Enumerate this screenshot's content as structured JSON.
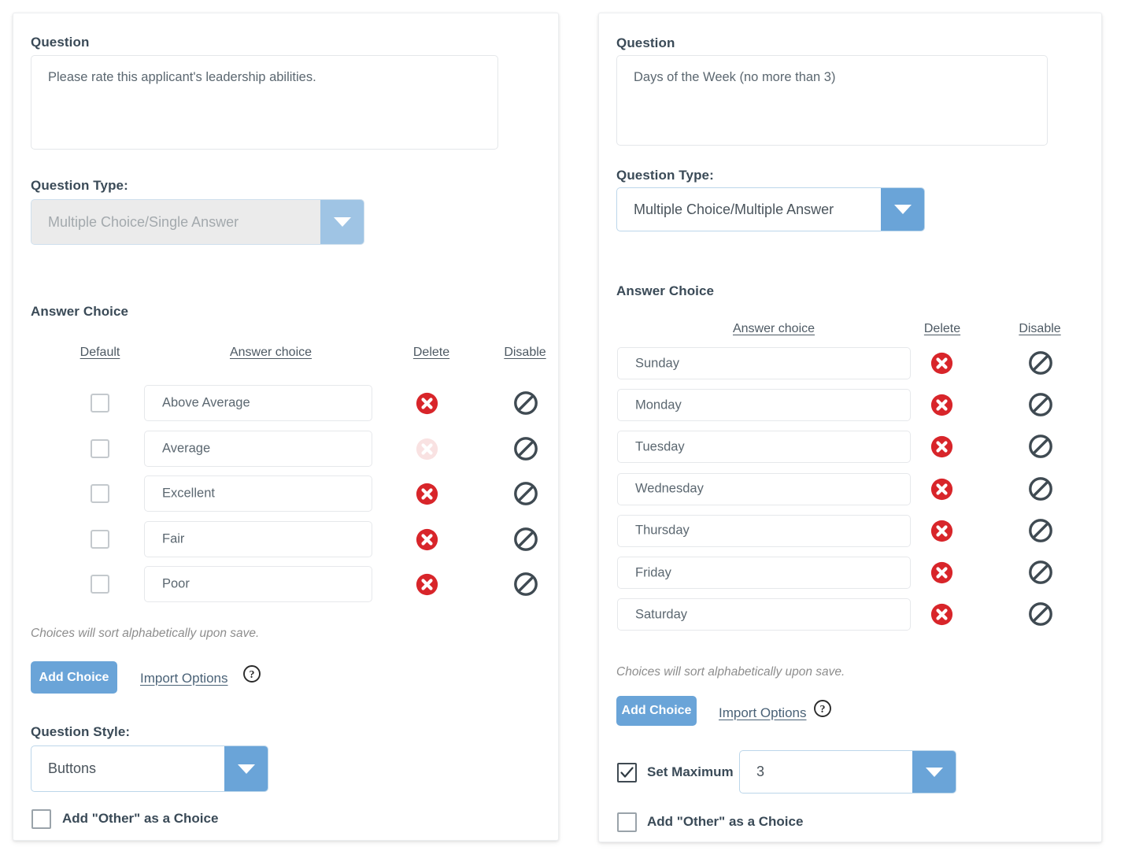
{
  "theme": {
    "accent_blue": "#6aa4d8",
    "accent_blue_muted": "#9fc4e4",
    "delete_red": "#d8252a",
    "disable_dark": "#3f4a52",
    "text_dark": "#3a4a57",
    "text_gray": "#5b6770",
    "note_gray": "#8d8d8d",
    "link_color": "#4a6277",
    "panel_bg": "#ffffff",
    "disabled_bg": "#ebebeb"
  },
  "left_panel": {
    "question_label": "Question",
    "question_text": "Please rate this applicant's leadership abilities.",
    "question_type_label": "Question Type:",
    "question_type_value": "Multiple Choice/Single Answer",
    "question_type_disabled": true,
    "answer_choice_label": "Answer Choice",
    "columns": {
      "default": "Default",
      "answer_choice": "Answer choice",
      "delete": "Delete",
      "disable": "Disable"
    },
    "rows": [
      {
        "default_checked": false,
        "text": "Above Average",
        "delete_icon": "delete-circle-x-icon",
        "delete_faded": false,
        "disable_icon": "disable-slash-icon"
      },
      {
        "default_checked": false,
        "text": "Average",
        "delete_icon": "delete-circle-x-icon",
        "delete_faded": true,
        "disable_icon": "disable-slash-icon"
      },
      {
        "default_checked": false,
        "text": "Excellent",
        "delete_icon": "delete-circle-x-icon",
        "delete_faded": false,
        "disable_icon": "disable-slash-icon"
      },
      {
        "default_checked": false,
        "text": "Fair",
        "delete_icon": "delete-circle-x-icon",
        "delete_faded": false,
        "disable_icon": "disable-slash-icon"
      },
      {
        "default_checked": false,
        "text": "Poor",
        "delete_icon": "delete-circle-x-icon",
        "delete_faded": false,
        "disable_icon": "disable-slash-icon"
      }
    ],
    "sort_note": "Choices will sort alphabetically upon save.",
    "add_choice_label": "Add Choice",
    "import_options_label": "Import Options",
    "help_icon": "help-question-circle-icon",
    "question_style_label": "Question Style:",
    "question_style_value": "Buttons",
    "add_other_label": "Add \"Other\" as a Choice",
    "add_other_checked": false
  },
  "right_panel": {
    "question_label": "Question",
    "question_text": "Days of the Week (no more than 3)",
    "question_type_label": "Question Type:",
    "question_type_value": "Multiple Choice/Multiple Answer",
    "question_type_disabled": false,
    "answer_choice_label": "Answer Choice",
    "columns": {
      "answer_choice": "Answer choice",
      "delete": "Delete",
      "disable": "Disable"
    },
    "rows": [
      {
        "text": "Sunday",
        "delete_icon": "delete-circle-x-icon",
        "disable_icon": "disable-slash-icon"
      },
      {
        "text": "Monday",
        "delete_icon": "delete-circle-x-icon",
        "disable_icon": "disable-slash-icon"
      },
      {
        "text": "Tuesday",
        "delete_icon": "delete-circle-x-icon",
        "disable_icon": "disable-slash-icon"
      },
      {
        "text": "Wednesday",
        "delete_icon": "delete-circle-x-icon",
        "disable_icon": "disable-slash-icon"
      },
      {
        "text": "Thursday",
        "delete_icon": "delete-circle-x-icon",
        "disable_icon": "disable-slash-icon"
      },
      {
        "text": "Friday",
        "delete_icon": "delete-circle-x-icon",
        "disable_icon": "disable-slash-icon"
      },
      {
        "text": "Saturday",
        "delete_icon": "delete-circle-x-icon",
        "disable_icon": "disable-slash-icon"
      }
    ],
    "sort_note": "Choices will sort alphabetically upon save.",
    "add_choice_label": "Add Choice",
    "import_options_label": "Import Options",
    "help_icon": "help-question-circle-icon",
    "set_maximum_label": "Set Maximum",
    "set_maximum_checked": true,
    "set_maximum_value": "3",
    "add_other_label": "Add \"Other\" as a Choice",
    "add_other_checked": false
  }
}
